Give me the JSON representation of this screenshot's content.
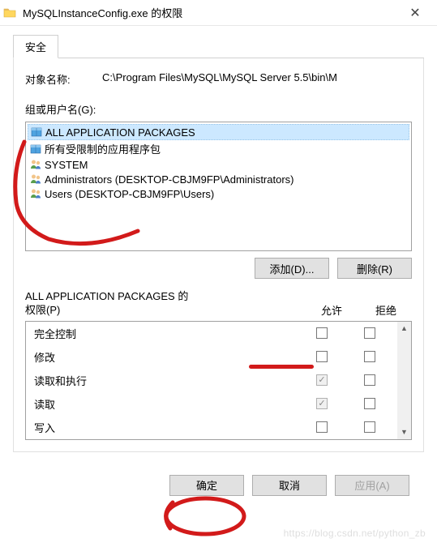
{
  "titlebar": {
    "title": "MySQLInstanceConfig.exe 的权限"
  },
  "tab": {
    "security": "安全"
  },
  "object": {
    "label": "对象名称:",
    "path": "C:\\Program Files\\MySQL\\MySQL Server 5.5\\bin\\M"
  },
  "groups": {
    "label": "组或用户名(G):",
    "items": [
      {
        "name": "ALL APPLICATION PACKAGES",
        "iconType": "package"
      },
      {
        "name": "所有受限制的应用程序包",
        "iconType": "package"
      },
      {
        "name": "SYSTEM",
        "iconType": "users"
      },
      {
        "name": "Administrators (DESKTOP-CBJM9FP\\Administrators)",
        "iconType": "users"
      },
      {
        "name": "Users (DESKTOP-CBJM9FP\\Users)",
        "iconType": "users"
      }
    ]
  },
  "buttons": {
    "add": "添加(D)...",
    "remove": "删除(R)",
    "ok": "确定",
    "cancel": "取消",
    "apply": "应用(A)"
  },
  "permissions": {
    "header_prefix": "ALL APPLICATION PACKAGES 的",
    "header_suffix": "权限(P)",
    "allow": "允许",
    "deny": "拒绝",
    "rows": [
      {
        "name": "完全控制",
        "allow": false,
        "allow_disabled": false,
        "deny": false
      },
      {
        "name": "修改",
        "allow": false,
        "allow_disabled": false,
        "deny": false
      },
      {
        "name": "读取和执行",
        "allow": true,
        "allow_disabled": true,
        "deny": false
      },
      {
        "name": "读取",
        "allow": true,
        "allow_disabled": true,
        "deny": false
      },
      {
        "name": "写入",
        "allow": false,
        "allow_disabled": false,
        "deny": false
      }
    ]
  },
  "watermark": "https://blog.csdn.net/python_zb"
}
